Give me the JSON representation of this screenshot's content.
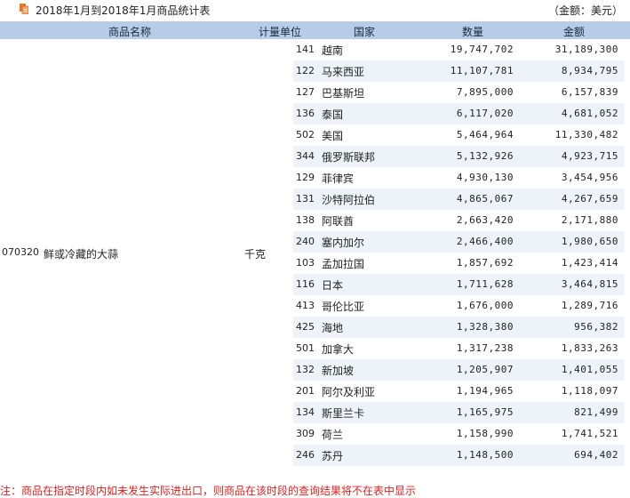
{
  "header": {
    "title": "2018年1月到2018年1月商品统计表",
    "unit_note": "（金额：美元）",
    "icon": "document-icon",
    "icon_color": "#e8762d"
  },
  "columns": {
    "product_name": "商品名称",
    "measure_unit": "计量单位",
    "country": "国家",
    "quantity": "数量",
    "amount": "金额"
  },
  "product": {
    "code": "070320",
    "name": "鲜或冷藏的大蒜",
    "unit": "千克"
  },
  "rows": [
    {
      "code": "141",
      "country": "越南",
      "quantity": "19,747,702",
      "amount": "31,189,300"
    },
    {
      "code": "122",
      "country": "马来西亚",
      "quantity": "11,107,781",
      "amount": "8,934,795"
    },
    {
      "code": "127",
      "country": "巴基斯坦",
      "quantity": "7,895,000",
      "amount": "6,157,839"
    },
    {
      "code": "136",
      "country": "泰国",
      "quantity": "6,117,020",
      "amount": "4,681,052"
    },
    {
      "code": "502",
      "country": "美国",
      "quantity": "5,464,964",
      "amount": "11,330,482"
    },
    {
      "code": "344",
      "country": "俄罗斯联邦",
      "quantity": "5,132,926",
      "amount": "4,923,715"
    },
    {
      "code": "129",
      "country": "菲律宾",
      "quantity": "4,930,130",
      "amount": "3,454,956"
    },
    {
      "code": "131",
      "country": "沙特阿拉伯",
      "quantity": "4,865,067",
      "amount": "4,267,659"
    },
    {
      "code": "138",
      "country": "阿联酋",
      "quantity": "2,663,420",
      "amount": "2,171,880"
    },
    {
      "code": "240",
      "country": "塞内加尔",
      "quantity": "2,466,400",
      "amount": "1,980,650"
    },
    {
      "code": "103",
      "country": "孟加拉国",
      "quantity": "1,857,692",
      "amount": "1,423,414"
    },
    {
      "code": "116",
      "country": "日本",
      "quantity": "1,711,628",
      "amount": "3,464,815"
    },
    {
      "code": "413",
      "country": "哥伦比亚",
      "quantity": "1,676,000",
      "amount": "1,289,716"
    },
    {
      "code": "425",
      "country": "海地",
      "quantity": "1,328,380",
      "amount": "956,382"
    },
    {
      "code": "501",
      "country": "加拿大",
      "quantity": "1,317,238",
      "amount": "1,833,263"
    },
    {
      "code": "132",
      "country": "新加坡",
      "quantity": "1,205,907",
      "amount": "1,401,055"
    },
    {
      "code": "201",
      "country": "阿尔及利亚",
      "quantity": "1,194,965",
      "amount": "1,118,097"
    },
    {
      "code": "134",
      "country": "斯里兰卡",
      "quantity": "1,165,975",
      "amount": "821,499"
    },
    {
      "code": "309",
      "country": "荷兰",
      "quantity": "1,158,990",
      "amount": "1,741,521"
    },
    {
      "code": "246",
      "country": "苏丹",
      "quantity": "1,148,500",
      "amount": "694,402"
    }
  ],
  "footnote": "注：商品在指定时段内如未发生实际进出口，则商品在该时段的查询结果将不在表中显示",
  "colors": {
    "header_bg": "#b7cce6",
    "row_alt_bg": "#eef3f9",
    "footnote": "#e02020"
  }
}
